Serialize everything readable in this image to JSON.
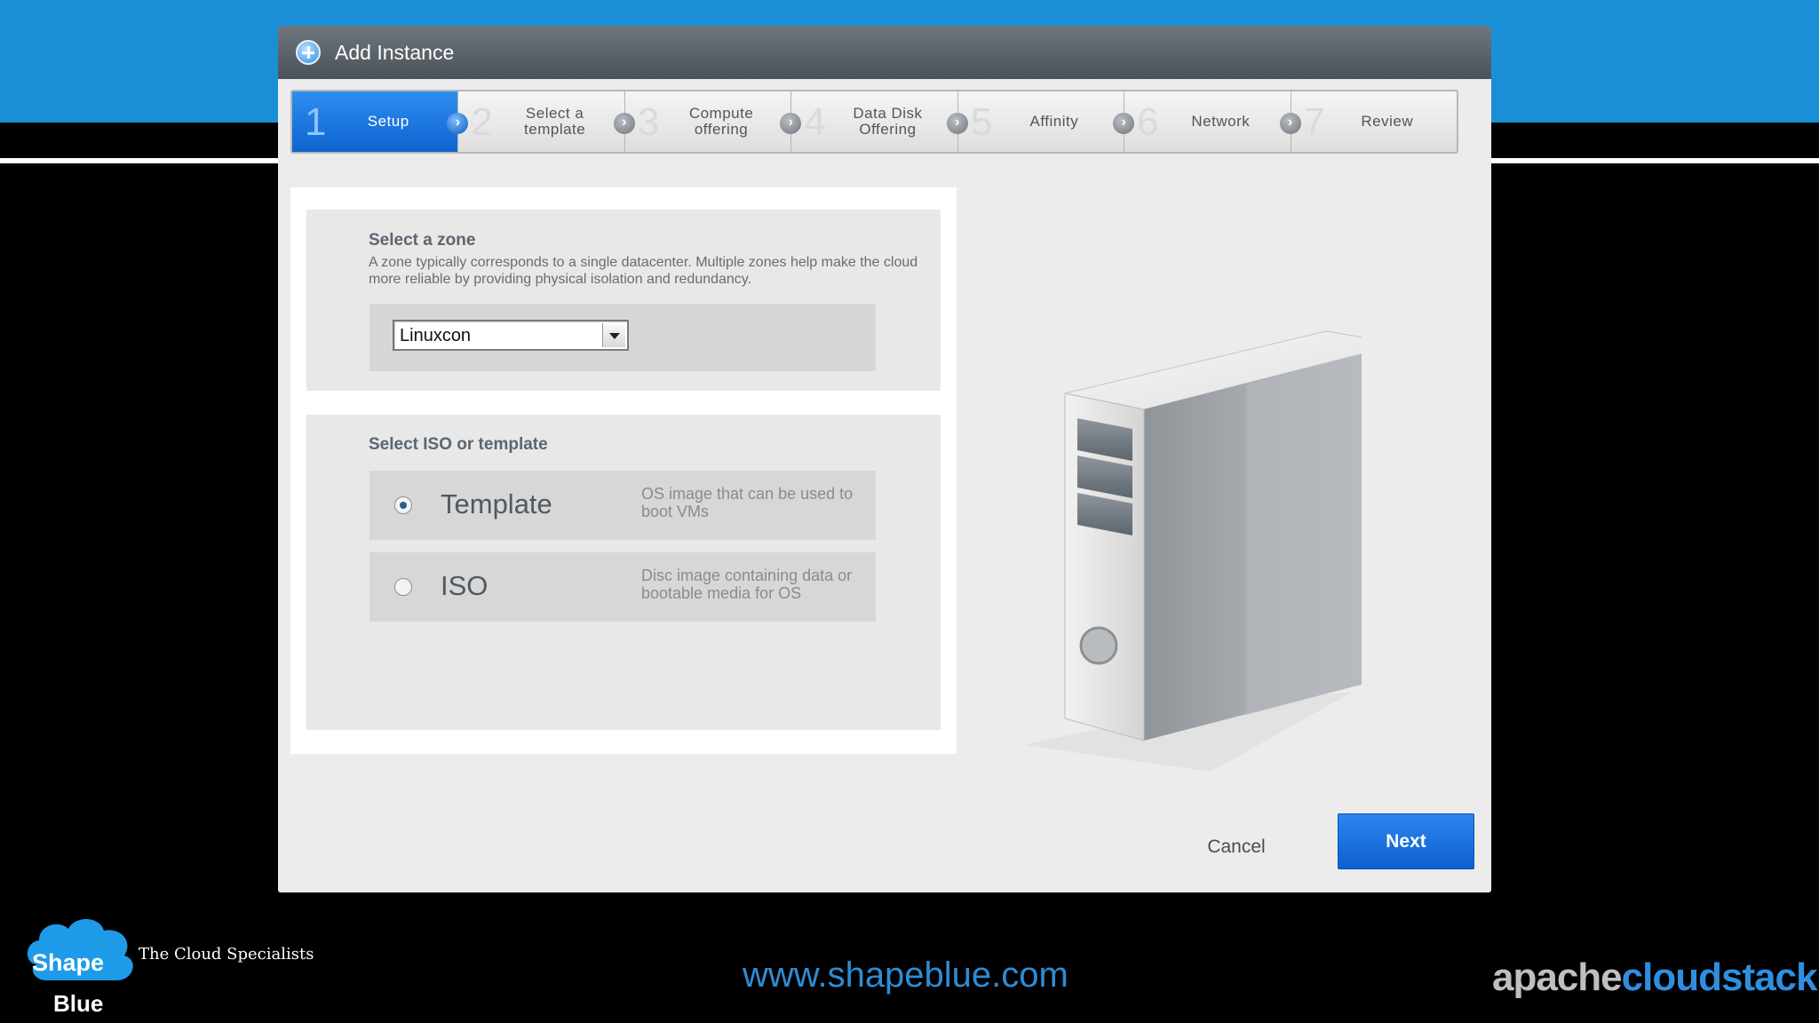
{
  "dialog": {
    "title": "Add Instance",
    "title_icon": "add-circle-icon"
  },
  "steps": [
    {
      "number": "1",
      "label": "Setup",
      "active": true
    },
    {
      "number": "2",
      "label": "Select a\ntemplate",
      "active": false
    },
    {
      "number": "3",
      "label": "Compute\noffering",
      "active": false
    },
    {
      "number": "4",
      "label": "Data Disk\nOffering",
      "active": false
    },
    {
      "number": "5",
      "label": "Affinity",
      "active": false
    },
    {
      "number": "6",
      "label": "Network",
      "active": false
    },
    {
      "number": "7",
      "label": "Review",
      "active": false
    }
  ],
  "zone": {
    "title": "Select a zone",
    "description": "A zone typically corresponds to a single datacenter. Multiple zones help make the cloud more reliable by providing physical isolation and redundancy.",
    "selected": "Linuxcon"
  },
  "iso_template": {
    "title": "Select ISO or template",
    "options": [
      {
        "label": "Template",
        "description": "OS image that can be used to boot VMs",
        "checked": true
      },
      {
        "label": "ISO",
        "description": "Disc image containing data or bootable media for OS",
        "checked": false
      }
    ]
  },
  "buttons": {
    "cancel": "Cancel",
    "next": "Next"
  },
  "footer": {
    "logo_word1": "Shape",
    "logo_word2": "Blue",
    "tagline": "The Cloud Specialists",
    "website": "www.shapeblue.com",
    "acs_part1": "apache",
    "acs_part2": "cloudstack"
  },
  "colors": {
    "top_band": "#1b8fd6",
    "active_step": "#1a73e0",
    "next_button": "#1565d8",
    "website_text": "#2e8cd4"
  }
}
